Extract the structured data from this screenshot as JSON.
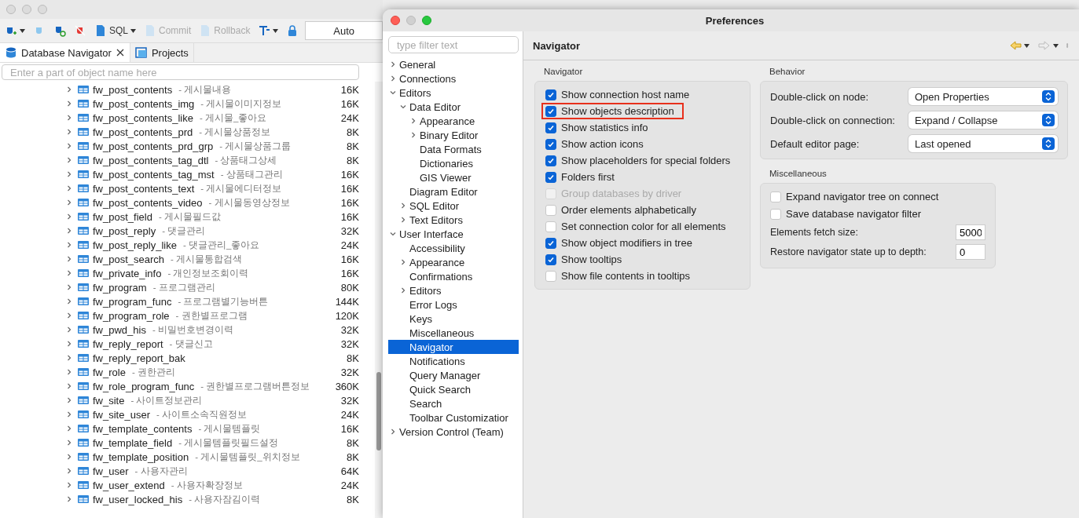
{
  "main_window": {
    "toolbar": [
      {
        "kind": "button",
        "label": "SQL",
        "disabled": false
      },
      {
        "kind": "button",
        "label": "Commit",
        "disabled": true
      },
      {
        "kind": "button",
        "label": "Rollback",
        "disabled": true
      },
      {
        "kind": "combo",
        "label": "Auto"
      }
    ],
    "tabs": [
      {
        "label": "Database Navigator",
        "selected": true
      },
      {
        "label": "Projects",
        "selected": false
      }
    ],
    "filter": {
      "placeholder": "Enter a part of object name here"
    },
    "tables": [
      {
        "name": "fw_post_contents",
        "description": "- 게시물내용",
        "size": "16K"
      },
      {
        "name": "fw_post_contents_img",
        "description": "- 게시물이미지정보",
        "size": "16K"
      },
      {
        "name": "fw_post_contents_like",
        "description": "- 게시물_좋아요",
        "size": "24K"
      },
      {
        "name": "fw_post_contents_prd",
        "description": "- 게시물상품정보",
        "size": "8K"
      },
      {
        "name": "fw_post_contents_prd_grp",
        "description": "- 게시물상품그룹",
        "size": "8K"
      },
      {
        "name": "fw_post_contents_tag_dtl",
        "description": "- 상품태그상세",
        "size": "8K"
      },
      {
        "name": "fw_post_contents_tag_mst",
        "description": "- 상품태그관리",
        "size": "16K"
      },
      {
        "name": "fw_post_contents_text",
        "description": "- 게시물에디터정보",
        "size": "16K"
      },
      {
        "name": "fw_post_contents_video",
        "description": "- 게시물동영상정보",
        "size": "16K"
      },
      {
        "name": "fw_post_field",
        "description": "- 게시물필드값",
        "size": "16K"
      },
      {
        "name": "fw_post_reply",
        "description": "- 댓글관리",
        "size": "32K"
      },
      {
        "name": "fw_post_reply_like",
        "description": "- 댓글관리_좋아요",
        "size": "24K"
      },
      {
        "name": "fw_post_search",
        "description": "- 게시물통합검색",
        "size": "16K"
      },
      {
        "name": "fw_private_info",
        "description": "- 개인정보조회이력",
        "size": "16K"
      },
      {
        "name": "fw_program",
        "description": "- 프로그램관리",
        "size": "80K"
      },
      {
        "name": "fw_program_func",
        "description": "- 프로그램별기능버튼",
        "size": "144K"
      },
      {
        "name": "fw_program_role",
        "description": "- 권한별프로그램",
        "size": "120K"
      },
      {
        "name": "fw_pwd_his",
        "description": "- 비밀번호변경이력",
        "size": "32K"
      },
      {
        "name": "fw_reply_report",
        "description": "- 댓글신고",
        "size": "32K"
      },
      {
        "name": "fw_reply_report_bak",
        "size": "8K"
      },
      {
        "name": "fw_role",
        "description": "- 권한관리",
        "size": "32K"
      },
      {
        "name": "fw_role_program_func",
        "description": "- 권한별프로그램버튼정보",
        "size": "360K"
      },
      {
        "name": "fw_site",
        "description": "- 사이트정보관리",
        "size": "32K"
      },
      {
        "name": "fw_site_user",
        "description": "- 사이트소속직원정보",
        "size": "24K"
      },
      {
        "name": "fw_template_contents",
        "description": "- 게시물템플릿",
        "size": "16K"
      },
      {
        "name": "fw_template_field",
        "description": "- 게시물템플릿필드설정",
        "size": "8K"
      },
      {
        "name": "fw_template_position",
        "description": "- 게시물템플릿_위치정보",
        "size": "8K"
      },
      {
        "name": "fw_user",
        "description": "- 사용자관리",
        "size": "64K"
      },
      {
        "name": "fw_user_extend",
        "description": "- 사용자확장정보",
        "size": "24K"
      },
      {
        "name": "fw_user_locked_his",
        "description": "- 사용자잠김이력",
        "size": "8K"
      }
    ]
  },
  "preferences": {
    "title": "Preferences",
    "filter": {
      "placeholder": "type filter text"
    },
    "tree": [
      {
        "label": "General",
        "expanded": false,
        "selected": false
      },
      {
        "label": "Connections",
        "expanded": false,
        "selected": false
      },
      {
        "label": "Editors",
        "expanded": true,
        "selected": false,
        "children": [
          {
            "label": "Data Editor",
            "expanded": true,
            "selected": false,
            "children": [
              {
                "label": "Appearance",
                "expanded": false,
                "selected": false
              },
              {
                "label": "Binary Editor",
                "expanded": false,
                "selected": false
              },
              {
                "label": "Data Formats",
                "selected": false
              },
              {
                "label": "Dictionaries",
                "selected": false
              },
              {
                "label": "GIS Viewer",
                "selected": false
              }
            ]
          },
          {
            "label": "Diagram Editor",
            "selected": false
          },
          {
            "label": "SQL Editor",
            "expanded": false,
            "selected": false
          },
          {
            "label": "Text Editors",
            "expanded": false,
            "selected": false
          }
        ]
      },
      {
        "label": "User Interface",
        "expanded": true,
        "selected": false,
        "children": [
          {
            "label": "Accessibility",
            "selected": false
          },
          {
            "label": "Appearance",
            "expanded": false,
            "selected": false
          },
          {
            "label": "Confirmations",
            "selected": false
          },
          {
            "label": "Editors",
            "expanded": false,
            "selected": false
          },
          {
            "label": "Error Logs",
            "selected": false
          },
          {
            "label": "Keys",
            "selected": false
          },
          {
            "label": "Miscellaneous",
            "selected": false
          },
          {
            "label": "Navigator",
            "selected": true
          },
          {
            "label": "Notifications",
            "selected": false
          },
          {
            "label": "Query Manager",
            "selected": false
          },
          {
            "label": "Quick Search",
            "selected": false
          },
          {
            "label": "Search",
            "selected": false
          },
          {
            "label": "Toolbar Customizatior",
            "selected": false
          }
        ]
      },
      {
        "label": "Version Control (Team)",
        "expanded": false,
        "selected": false
      }
    ],
    "page_title": "Navigator",
    "navigator_group": {
      "title": "Navigator",
      "options": [
        {
          "label": "Show connection host name",
          "checked": true,
          "disabled": false,
          "highlighted": false
        },
        {
          "label": "Show objects description",
          "checked": true,
          "disabled": false,
          "highlighted": true
        },
        {
          "label": "Show statistics info",
          "checked": true,
          "disabled": false,
          "highlighted": false
        },
        {
          "label": "Show action icons",
          "checked": true,
          "disabled": false,
          "highlighted": false
        },
        {
          "label": "Show placeholders for special folders",
          "checked": true,
          "disabled": false,
          "highlighted": false
        },
        {
          "label": "Folders first",
          "checked": true,
          "disabled": false,
          "highlighted": false
        },
        {
          "label": "Group databases by driver",
          "checked": false,
          "disabled": true,
          "highlighted": false
        },
        {
          "label": "Order elements alphabetically",
          "checked": false,
          "disabled": false,
          "highlighted": false
        },
        {
          "label": "Set connection color for all elements",
          "checked": false,
          "disabled": false,
          "highlighted": false
        },
        {
          "label": "Show object modifiers in tree",
          "checked": true,
          "disabled": false,
          "highlighted": false
        },
        {
          "label": "Show tooltips",
          "checked": true,
          "disabled": false,
          "highlighted": false
        },
        {
          "label": "Show file contents in tooltips",
          "checked": false,
          "disabled": false,
          "highlighted": false
        }
      ]
    },
    "behavior_group": {
      "title": "Behavior",
      "selects": [
        {
          "label": "Double-click on node:",
          "value": "Open Properties"
        },
        {
          "label": "Double-click on connection:",
          "value": "Expand / Collapse"
        },
        {
          "label": "Default editor page:",
          "value": "Last opened"
        }
      ]
    },
    "misc_group": {
      "title": "Miscellaneous",
      "options": [
        {
          "label": "Expand navigator tree on connect",
          "checked": false
        },
        {
          "label": "Save database navigator filter",
          "checked": false
        }
      ],
      "fields": [
        {
          "label": "Elements fetch size:",
          "value": "5000"
        },
        {
          "label": "Restore navigator state up to depth:",
          "value": "0"
        }
      ]
    }
  }
}
